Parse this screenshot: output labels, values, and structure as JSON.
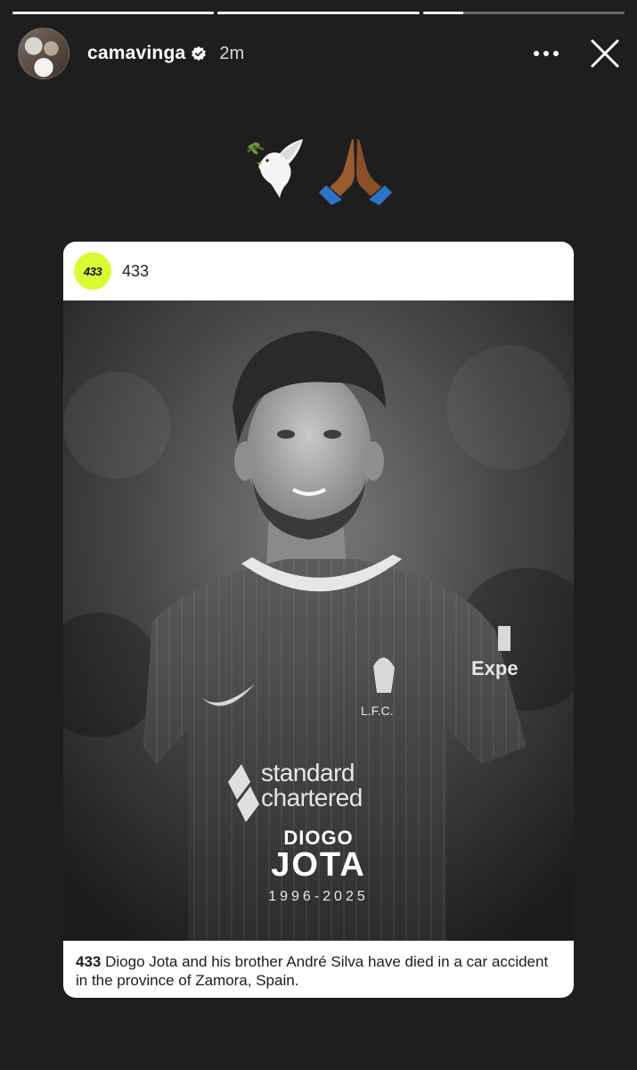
{
  "story": {
    "progress": [
      1.0,
      1.0,
      0.2
    ],
    "account": "camavinga",
    "verified": true,
    "time_ago": "2m",
    "icons": {
      "more": "more-horizontal-icon",
      "close": "close-icon"
    }
  },
  "caption_emojis": [
    "dove-with-olive-branch-emoji",
    "folded-hands-emoji"
  ],
  "shared_post": {
    "account": "433",
    "logo_text": "433",
    "logo_color": "#dbfa34",
    "image": {
      "first_name": "DIOGO",
      "last_name": "JOTA",
      "years": "1996-2025",
      "shirt_sponsor_line1": "standard",
      "shirt_sponsor_line2": "chartered",
      "crest_text": "L.F.C.",
      "sleeve_text": "Expe"
    },
    "caption_account": "433",
    "caption_text": "Diogo Jota and his brother André Silva have died in a car accident in the province of Zamora, Spain."
  }
}
